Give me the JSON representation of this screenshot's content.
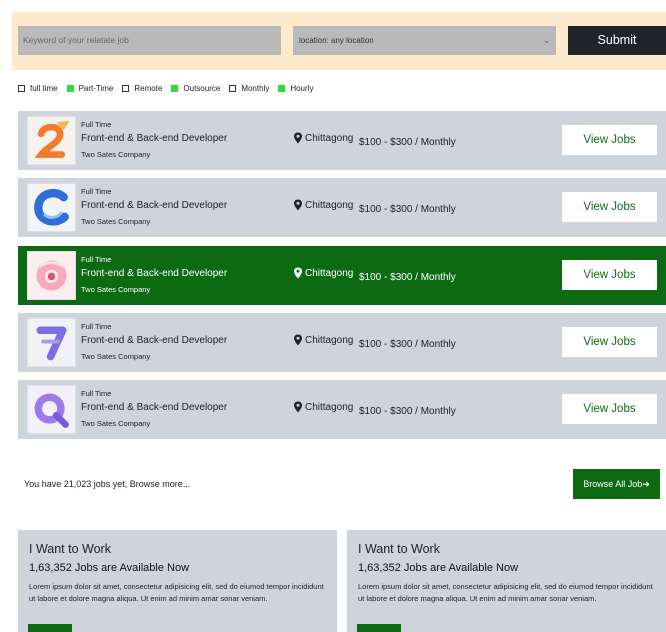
{
  "search": {
    "keyword_placeholder": "Keyword of your relatate job",
    "location_value": "location: any location",
    "submit_label": "Submit"
  },
  "filters": [
    {
      "label": "full time",
      "checked": false
    },
    {
      "label": "Part-Time",
      "checked": true
    },
    {
      "label": "Remote",
      "checked": false
    },
    {
      "label": "Outsource",
      "checked": true
    },
    {
      "label": "Monthly",
      "checked": false
    },
    {
      "label": "Hourly",
      "checked": true
    }
  ],
  "jobs": [
    {
      "type": "Full Time",
      "title": "Front-end & Back-end Developer",
      "company": "Two Sates Company",
      "location": "Chittagong",
      "salary": "$100 - $300 / Monthly",
      "button": "View Jobs",
      "logo": "number-2-logo",
      "highlighted": false
    },
    {
      "type": "Full Time",
      "title": "Front-end & Back-end Developer",
      "company": "Two Sates Company",
      "location": "Chittagong",
      "salary": "$100 - $300 / Monthly",
      "button": "View Jobs",
      "logo": "letter-c-logo",
      "highlighted": false
    },
    {
      "type": "Full Time",
      "title": "Front-end & Back-end Developer",
      "company": "Two Sates Company",
      "location": "Chittagong",
      "salary": "$100 - $300 / Monthly",
      "button": "View Jobs",
      "logo": "pink-ring-logo",
      "highlighted": true
    },
    {
      "type": "Full Time",
      "title": "Front-end & Back-end Developer",
      "company": "Two Sates Company",
      "location": "Chittagong",
      "salary": "$100 - $300 / Monthly",
      "button": "View Jobs",
      "logo": "number-7-logo",
      "highlighted": false
    },
    {
      "type": "Full Time",
      "title": "Front-end & Back-end Developer",
      "company": "Two Sates Company",
      "location": "Chittagong",
      "salary": "$100 - $300 / Monthly",
      "button": "View Jobs",
      "logo": "letter-q-logo",
      "highlighted": false
    }
  ],
  "summary": {
    "text": "You have 21,023 jobs yet, Browse more...",
    "browse_label": "Browse All Job"
  },
  "cards": [
    {
      "heading": "I Want to Work",
      "subheading": "1,63,352 Jobs are Available Now",
      "text": "Lorem ipsum dolor sit amet, consectetur adipisicing elit, sed do eiumod tempor incididunt ut labore et dolore magna aliqua. Ut enim ad minim amar sonar veniam."
    },
    {
      "heading": "I Want to Work",
      "subheading": "1,63,352 Jobs are Available Now",
      "text": "Lorem ipsum dolor sit amet, consectetur adipisicing elit, sed do eiumod tempor incididunt ut labore et dolore magna aliqua. Ut enim ad minim amar sonar veniam."
    }
  ],
  "colors": {
    "accent_green": "#0d6a13",
    "filter_checked": "#33dd33",
    "search_background": "#fde9cb",
    "row_background": "#cfd3db"
  }
}
